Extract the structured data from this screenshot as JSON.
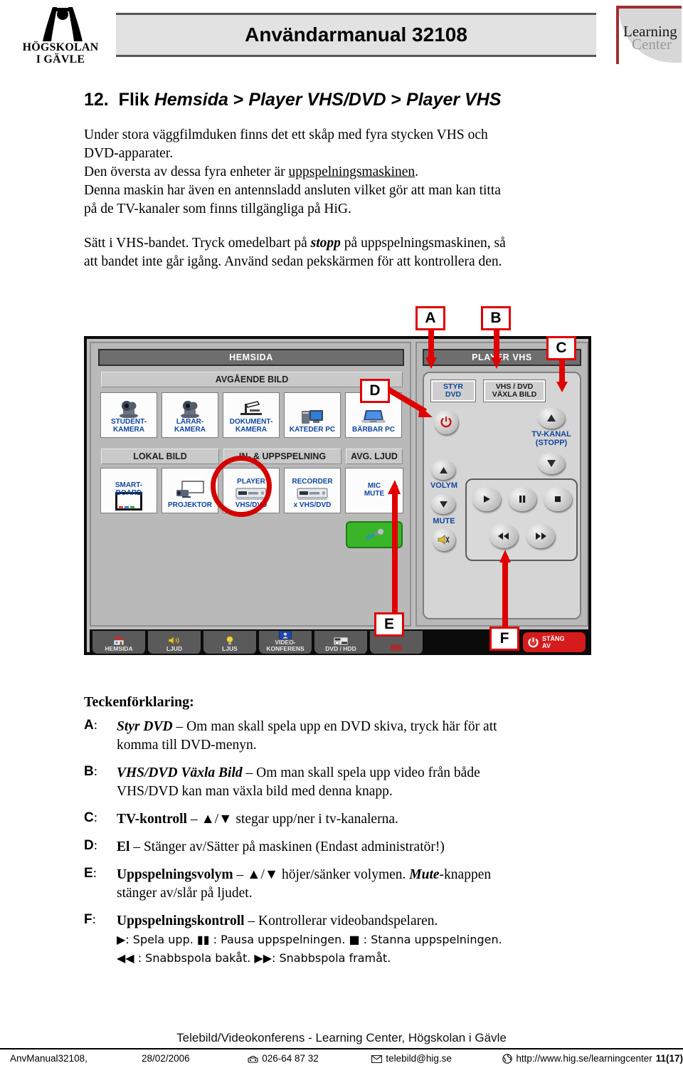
{
  "header": {
    "org_logo_line1": "HÖGSKOLAN",
    "org_logo_line2": "I GÄVLE",
    "document_title": "Användarmanual 32108",
    "lc_logo_line1": "Learning",
    "lc_logo_line2": "Center"
  },
  "section": {
    "number": "12.",
    "title_plain_1": "Flik ",
    "title_italic_1": "Hemsida",
    "title_sep_1": " > ",
    "title_italic_2": "Player VHS/DVD",
    "title_sep_2": " > ",
    "title_italic_3": "Player VHS"
  },
  "paragraphs": {
    "p1_line1": "Under stora väggfilmduken finns det ett skåp med fyra stycken VHS och",
    "p1_line2a": "DVD-apparater.",
    "p1_line3a": "Den översta av dessa fyra enheter är ",
    "p1_line3_underlined": "uppspelningsmaskinen",
    "p1_line3b": ".",
    "p1_line4": "Denna maskin har även en antennsladd ansluten vilket gör att man kan titta",
    "p1_line5": "på de TV-kanaler som finns tillgängliga på HiG.",
    "p2_a": "Sätt i VHS-bandet. Tryck omedelbart på ",
    "p2_bold_italic": "stopp",
    "p2_b": " på uppspelningsmaskinen, så",
    "p2_c": "att bandet inte går igång. Använd sedan pekskärmen för att kontrollera den."
  },
  "touchscreen": {
    "left_title": "HEMSIDA",
    "right_title": "PLAYER VHS",
    "group_avgaende_bild": "AVGÅENDE BILD",
    "group_lokal_bild": "LOKAL BILD",
    "group_in_uppspelning": "IN- & UPPSPELNING",
    "group_avg_ljud": "AVG. LJUD",
    "source_buttons": [
      {
        "label": "STUDENT-\nKAMERA",
        "icon": "camera-icon"
      },
      {
        "label": "LÄRAR-\nKAMERA",
        "icon": "camera-icon"
      },
      {
        "label": "DOKUMENT-\nKAMERA",
        "icon": "document-camera-icon"
      },
      {
        "label": "KATEDER PC",
        "icon": "desktop-pc-icon"
      },
      {
        "label": "BÄRBAR PC",
        "icon": "laptop-icon"
      }
    ],
    "output_buttons": [
      {
        "label": "SMART-\nBOARD",
        "icon": "whiteboard-icon"
      },
      {
        "label": "PROJEKTOR",
        "icon": "projector-icon"
      },
      {
        "label_top": "PLAYER",
        "label_bottom": "VHS/DVD",
        "icon": "vcr-icon"
      },
      {
        "label_top": "RECORDER",
        "label_bottom": "x VHS/DVD",
        "icon": "vcr-icon"
      },
      {
        "label": "MIC\nMUTE",
        "icon": "microphone-icon"
      }
    ],
    "nav_tabs": [
      {
        "label": "HEMSIDA",
        "icon": "house-icon"
      },
      {
        "label": "LJUD",
        "icon": "speaker-icon"
      },
      {
        "label": "LJUS",
        "icon": "lightbulb-icon"
      },
      {
        "label": "VIDEO-\nKONFERENS",
        "icon": "videoconference-icon"
      },
      {
        "label": "DVD / HDD",
        "icon": "dvd-icon"
      },
      {
        "label": "",
        "icon": "generic-icon"
      }
    ],
    "power_off_label_line1": "STÄNG",
    "power_off_label_line2": "AV",
    "remote": {
      "styr_dvd": "STYR\nDVD",
      "vaxla_bild": "VHS / DVD\nVÄXLA BILD",
      "tv_kanal": "TV-KANAL\n(STOPP)",
      "volym": "VOLYM",
      "mute": "MUTE"
    },
    "annotations": [
      "A",
      "B",
      "C",
      "D",
      "E",
      "F"
    ],
    "highlight_color": "#d40000"
  },
  "legend": {
    "heading": "Teckenförklaring:",
    "items": [
      {
        "key": "A",
        "term": "Styr DVD",
        "term_style": "bold-italic",
        "line1": " – Om man skall spela upp en DVD skiva, tryck här för att",
        "line2": "komma till DVD-menyn."
      },
      {
        "key": "B",
        "term": "VHS/DVD Växla Bild",
        "term_style": "bold-italic",
        "line1": " – Om man skall spela upp video från både",
        "line2": "VHS/DVD kan man växla bild med denna knapp."
      },
      {
        "key": "C",
        "term": "TV-kontroll",
        "term_style": "bold",
        "line1": " – ▲/▼ stegar upp/ner i tv-kanalerna.",
        "line2": ""
      },
      {
        "key": "D",
        "term": "El",
        "term_style": "bold",
        "line1": " – Stänger av/Sätter på maskinen (Endast administratör!)",
        "line2": ""
      },
      {
        "key": "E",
        "term": "Uppspelningsvolym",
        "term_style": "bold",
        "line1": " – ▲/▼ höjer/sänker volymen. ",
        "line1_bi": "Mute",
        "line1_tail": "-knappen",
        "line2": "stänger av/slår på ljudet."
      },
      {
        "key": "F",
        "term": "Uppspelningskontroll",
        "term_style": "bold",
        "line1": " – Kontrollerar videobandspelaren.",
        "line2": "▶: Spela upp.  ▮▮ : Pausa uppspelningen.  ■ : Stanna uppspelningen.",
        "line3": "◀◀ : Snabbspola bakåt. ▶▶: Snabbspola framåt."
      }
    ]
  },
  "footer": {
    "title": "Telebild/Videokonferens - Learning Center, Högskolan i Gävle",
    "doc_id": "AnvManual32108,",
    "date": "28/02/2006",
    "phone_icon": "telephone-icon",
    "phone": "026-64 87 32",
    "mail_icon": "envelope-icon",
    "email": "telebild@hig.se",
    "web_icon": "globe-icon",
    "url": "http://www.hig.se/learningcenter",
    "page": "11(17)"
  }
}
